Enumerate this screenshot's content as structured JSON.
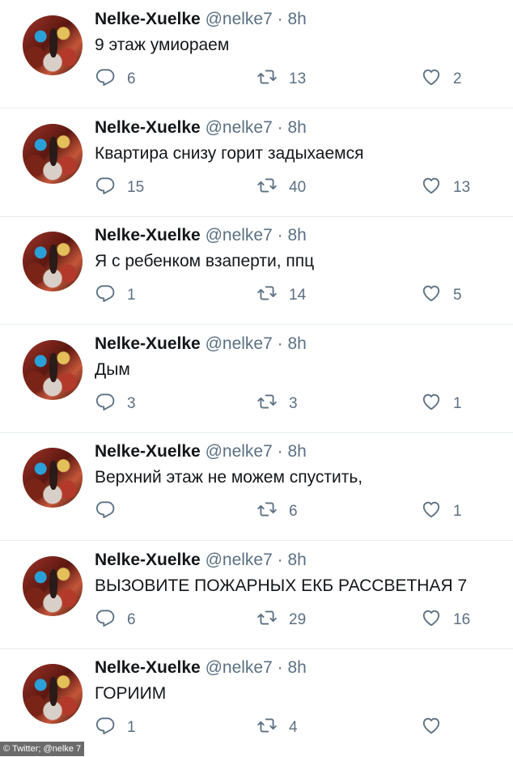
{
  "tweets": [
    {
      "name": "Nelke-Xuelke",
      "handle": "@nelke7",
      "dot": "·",
      "time": "8h",
      "text": "9 этаж умиораем",
      "replies": "6",
      "retweets": "13",
      "likes": "2"
    },
    {
      "name": "Nelke-Xuelke",
      "handle": "@nelke7",
      "dot": "·",
      "time": "8h",
      "text": "Квартира снизу горит задыхаемся",
      "replies": "15",
      "retweets": "40",
      "likes": "13"
    },
    {
      "name": "Nelke-Xuelke",
      "handle": "@nelke7",
      "dot": "·",
      "time": "8h",
      "text": "Я с ребенком взаперти, ппц",
      "replies": "1",
      "retweets": "14",
      "likes": "5"
    },
    {
      "name": "Nelke-Xuelke",
      "handle": "@nelke7",
      "dot": "·",
      "time": "8h",
      "text": "Дым",
      "replies": "3",
      "retweets": "3",
      "likes": "1"
    },
    {
      "name": "Nelke-Xuelke",
      "handle": "@nelke7",
      "dot": "·",
      "time": "8h",
      "text": "Верхний этаж не можем спустить,",
      "replies": "",
      "retweets": "6",
      "likes": "1"
    },
    {
      "name": "Nelke-Xuelke",
      "handle": "@nelke7",
      "dot": "·",
      "time": "8h",
      "text": "ВЫЗОВИТЕ ПОЖАРНЫХ ЕКБ РАССВЕТНАЯ 7",
      "replies": "6",
      "retweets": "29",
      "likes": "16"
    },
    {
      "name": "Nelke-Xuelke",
      "handle": "@nelke7",
      "dot": "·",
      "time": "8h",
      "text": "ГОРИИМ",
      "replies": "1",
      "retweets": "4",
      "likes": ""
    }
  ],
  "icons": {
    "reply": "reply-icon",
    "retweet": "retweet-icon",
    "like": "like-icon"
  },
  "credit": "© Twitter; @nelke 7"
}
